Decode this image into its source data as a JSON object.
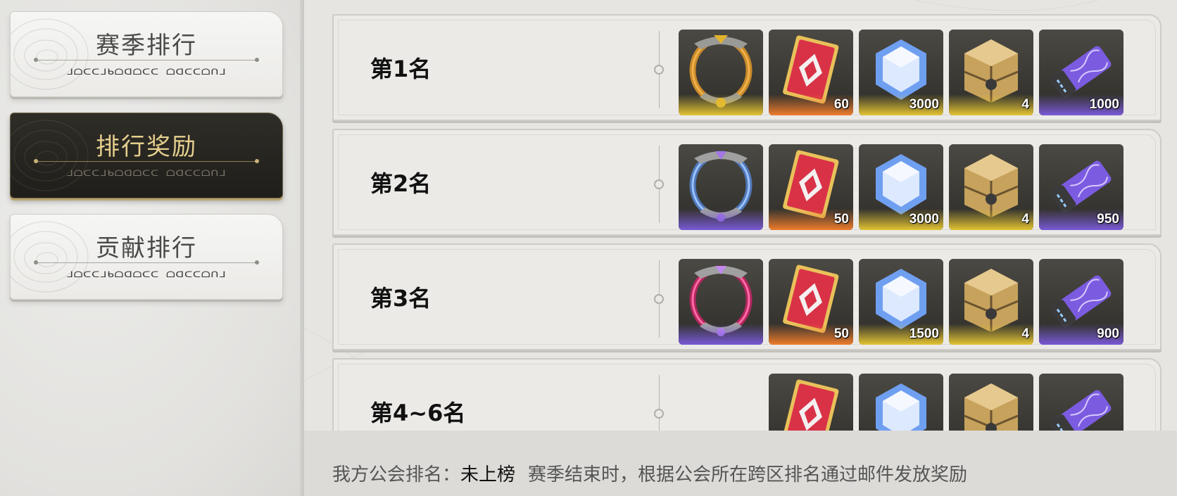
{
  "nav": {
    "items": [
      {
        "label": "赛季排行",
        "glyph": "ᒧᗝᑕᑕᒧᑲᗝᗡᗝᑕᑕ ᗝᗡᑕᑕᗝᑎᒧ",
        "active": false
      },
      {
        "label": "排行奖励",
        "glyph": "ᒧᗝᑕᑕᒧᑲᗝᗡᗝᑕᑕ ᗝᗡᑕᑕᗝᑎᒧ",
        "active": true
      },
      {
        "label": "贡献排行",
        "glyph": "ᒧᗝᑕᑕᒧᑲᗝᗡᗝᑕᑕ ᗝᗡᑕᑕᗝᑎᒧ",
        "active": false
      }
    ]
  },
  "rewards": [
    {
      "rank": "第1名",
      "items": [
        {
          "icon": "avatar-frame-gold-icon",
          "count": "",
          "rarity": "gold"
        },
        {
          "icon": "red-card-ticket-icon",
          "count": "60",
          "rarity": "orange"
        },
        {
          "icon": "blue-crystal-icon",
          "count": "3000",
          "rarity": "gold"
        },
        {
          "icon": "gold-chest-icon",
          "count": "4",
          "rarity": "gold"
        },
        {
          "icon": "dna-capsule-icon",
          "count": "1000",
          "rarity": "purple"
        }
      ]
    },
    {
      "rank": "第2名",
      "items": [
        {
          "icon": "avatar-frame-blue-icon",
          "count": "",
          "rarity": "purple"
        },
        {
          "icon": "red-card-ticket-icon",
          "count": "50",
          "rarity": "orange"
        },
        {
          "icon": "blue-crystal-icon",
          "count": "3000",
          "rarity": "gold"
        },
        {
          "icon": "gold-chest-icon",
          "count": "4",
          "rarity": "gold"
        },
        {
          "icon": "dna-capsule-icon",
          "count": "950",
          "rarity": "purple"
        }
      ]
    },
    {
      "rank": "第3名",
      "items": [
        {
          "icon": "avatar-frame-pink-icon",
          "count": "",
          "rarity": "purple"
        },
        {
          "icon": "red-card-ticket-icon",
          "count": "50",
          "rarity": "orange"
        },
        {
          "icon": "blue-crystal-icon",
          "count": "1500",
          "rarity": "gold"
        },
        {
          "icon": "gold-chest-icon",
          "count": "4",
          "rarity": "gold"
        },
        {
          "icon": "dna-capsule-icon",
          "count": "900",
          "rarity": "purple"
        }
      ]
    },
    {
      "rank": "第4~6名",
      "items": [
        {
          "icon": "red-card-ticket-icon",
          "count": "",
          "rarity": "orange"
        },
        {
          "icon": "blue-crystal-icon",
          "count": "",
          "rarity": "gold"
        },
        {
          "icon": "gold-chest-icon",
          "count": "",
          "rarity": "gold"
        },
        {
          "icon": "dna-capsule-icon",
          "count": "",
          "rarity": "purple"
        }
      ]
    }
  ],
  "footer": {
    "label": "我方公会排名：",
    "value": "未上榜",
    "note": "赛季结束时，根据公会所在跨区排名通过邮件发放奖励"
  },
  "colors": {
    "active_gold": "#e6cf8e",
    "rarity_gold": "#e4c433",
    "rarity_orange": "#ef7d2d",
    "rarity_purple": "#7a5ad6"
  }
}
